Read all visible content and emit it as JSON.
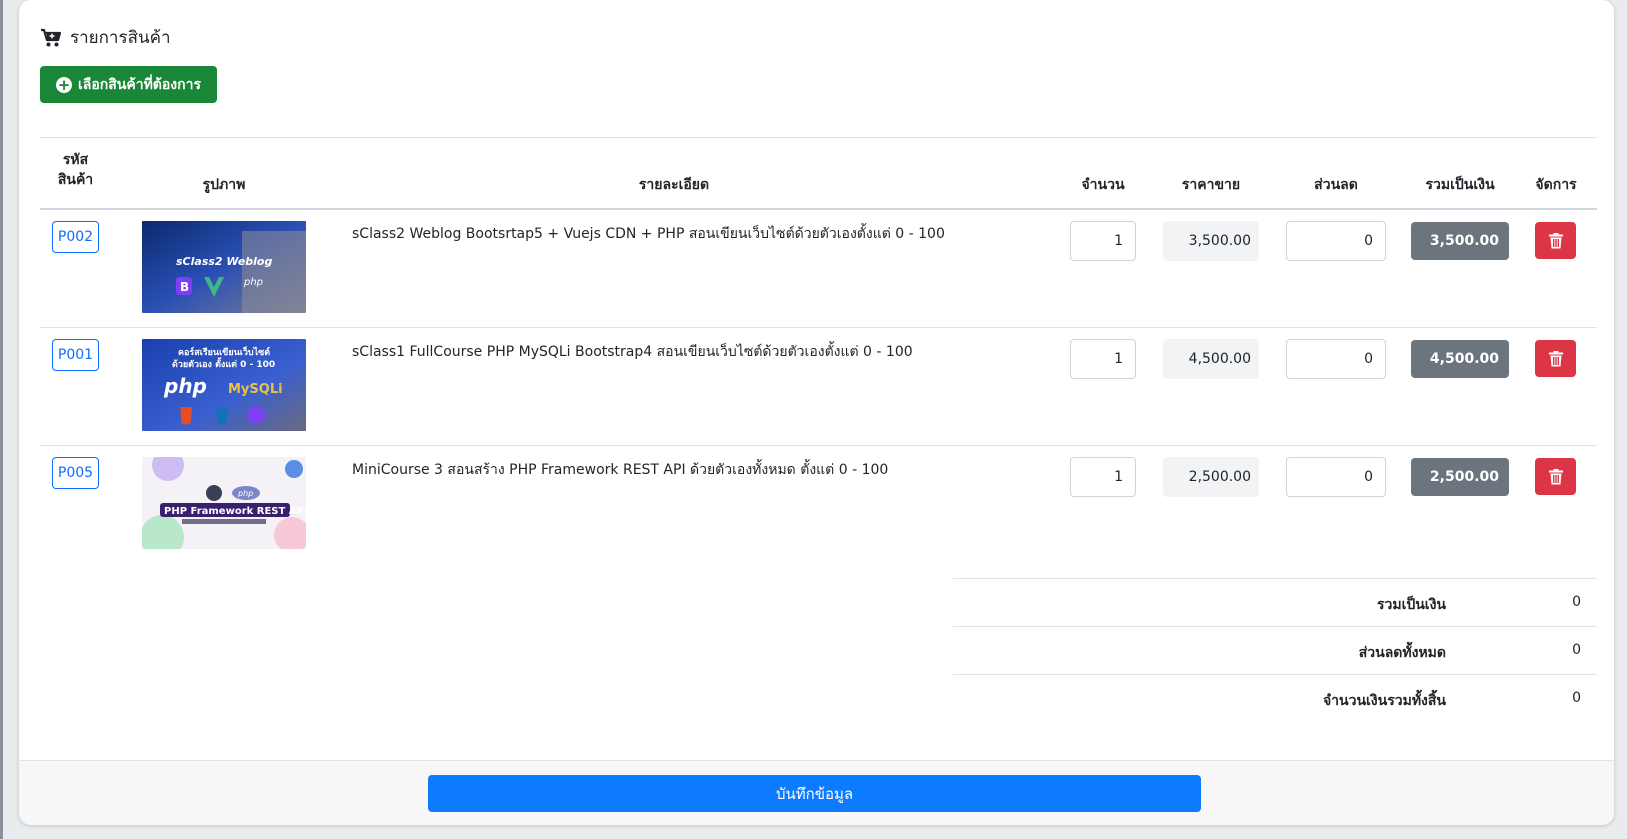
{
  "section": {
    "title": "รายการสินค้า",
    "icon": "shopping-cart-icon",
    "select_button": "เลือกสินค้าที่ต้องการ"
  },
  "table": {
    "headers": {
      "code_line1": "รหัส",
      "code_line2": "สินค้า",
      "image": "รูปภาพ",
      "detail": "รายละเอียด",
      "qty": "จำนวน",
      "price": "ราคาขาย",
      "discount": "ส่วนลด",
      "total": "รวมเป็นเงิน",
      "manage": "จัดการ"
    },
    "rows": [
      {
        "code": "P002",
        "detail": "sClass2 Weblog Bootsrtap5 + Vuejs CDN + PHP สอนเขียนเว็บไซต์ด้วยตัวเองตั้งแต่ 0 - 100",
        "qty": "1",
        "price": "3,500.00",
        "discount": "0",
        "total": "3,500.00",
        "thumb_text": "sClass2 Weblog"
      },
      {
        "code": "P001",
        "detail": "sClass1 FullCourse PHP MySQLi Bootstrap4 สอนเขียนเว็บไซต์ด้วยตัวเองตั้งแต่ 0 - 100",
        "qty": "1",
        "price": "4,500.00",
        "discount": "0",
        "total": "4,500.00",
        "thumb_text_line1": "คอร์สเรียนเขียนเว็บไซต์",
        "thumb_text_line2": "ด้วยตัวเอง ตั้งแต่ 0 - 100"
      },
      {
        "code": "P005",
        "detail": "MiniCourse 3 สอนสร้าง PHP Framework REST API ด้วยตัวเองทั้งหมด ตั้งแต่ 0 - 100",
        "qty": "1",
        "price": "2,500.00",
        "discount": "0",
        "total": "2,500.00",
        "thumb_text": "PHP Framework REST API"
      }
    ]
  },
  "summary": {
    "subtotal_label": "รวมเป็นเงิน",
    "subtotal_value": "0",
    "discount_label": "ส่วนลดทั้งหมด",
    "discount_value": "0",
    "grand_label": "จำนวนเงินรวมทั้งสิ้น",
    "grand_value": "0"
  },
  "footer": {
    "save_button": "บันทึกข้อมูล"
  },
  "colors": {
    "select_button": "#198737",
    "save_button": "#0d7bff",
    "delete_button": "#dc3545",
    "total_badge": "#6c757d",
    "code_badge": "#0d6efd"
  }
}
